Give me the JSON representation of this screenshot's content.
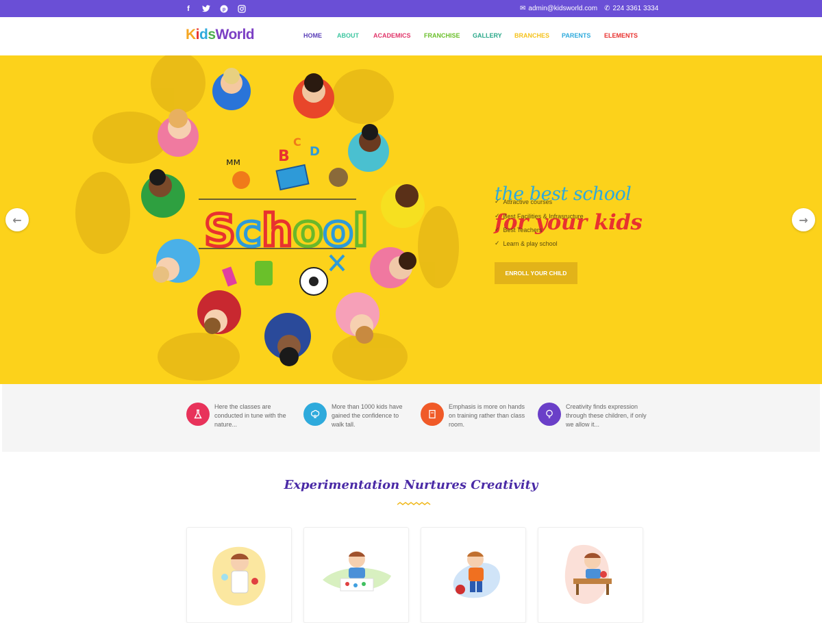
{
  "topbar": {
    "social": [
      "facebook-icon",
      "twitter-icon",
      "pinterest-icon",
      "instagram-icon"
    ],
    "email": "admin@kidsworld.com",
    "phone": "224 3361 3334"
  },
  "logo": {
    "k": "K",
    "i": "i",
    "d": "d",
    "s": "s",
    "world": "World"
  },
  "nav": [
    {
      "label": "HOME",
      "color": "#5a3fb8"
    },
    {
      "label": "ABOUT",
      "color": "#3dc6a0"
    },
    {
      "label": "ACADEMICS",
      "color": "#e0356a"
    },
    {
      "label": "FRANCHISE",
      "color": "#6abf2a"
    },
    {
      "label": "GALLERY",
      "color": "#2aa88a"
    },
    {
      "label": "BRANCHES",
      "color": "#f5c21b"
    },
    {
      "label": "PARENTS",
      "color": "#2eaadc"
    },
    {
      "label": "ELEMENTS",
      "color": "#e8322f"
    }
  ],
  "hero": {
    "tagline_1": "the best school",
    "tagline_2": "for your kids",
    "features": [
      "Attractive courses",
      "Best Facilities & Infrasructure",
      "Best Teachers",
      "Learn & play school"
    ],
    "cta": "ENROLL YOUR CHILD",
    "art_text": "School",
    "prev_arrow": "prev-arrow",
    "next_arrow": "next-arrow"
  },
  "features": [
    {
      "text": "Here the classes are conducted in tune with the nature...",
      "color": "#e8325a",
      "icon": "flask-icon"
    },
    {
      "text": "More than 1000 kids have gained the confidence to walk tall.",
      "color": "#2eaadc",
      "icon": "brain-icon"
    },
    {
      "text": "Emphasis is more on hands on training rather than class room.",
      "color": "#f05a28",
      "icon": "book-icon"
    },
    {
      "text": "Creativity finds expression through these children, if only we allow it...",
      "color": "#6a3fc8",
      "icon": "bulb-icon"
    }
  ],
  "section": {
    "title": "Experimentation Nurtures Creativity"
  }
}
